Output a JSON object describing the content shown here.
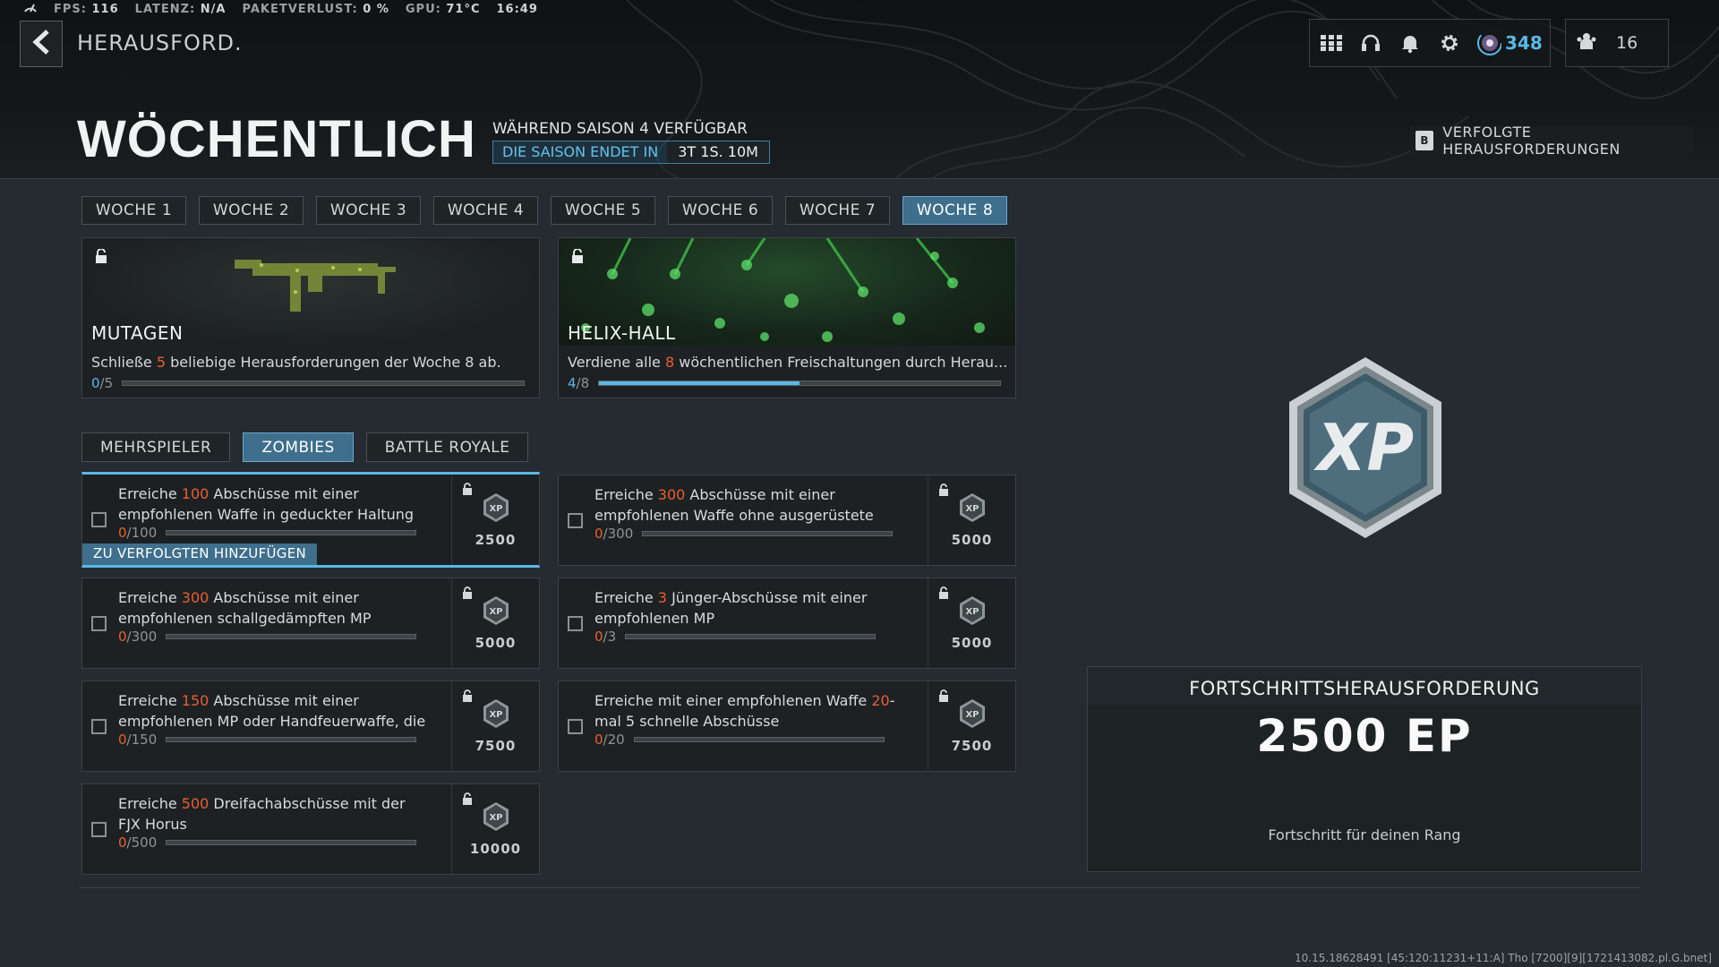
{
  "status_bar": {
    "fps_label": "FPS:",
    "fps": "116",
    "latency_label": "LATENZ:",
    "latency": "N/A",
    "packetloss_label": "PAKETVERLUST:",
    "packetloss": "0 %",
    "gpu_label": "GPU:",
    "gpu": "71°C",
    "clock": "16:49"
  },
  "header": {
    "breadcrumb": "HERAUSFORD.",
    "title": "WÖCHENTLICH",
    "availability": "WÄHREND SAISON 4 VERFÜGBAR",
    "season_end_label": "DIE SAISON ENDET IN",
    "season_end_value": "3T 1S. 10M",
    "tracked_key": "B",
    "tracked_label": "VERFOLGTE HERAUSFORDERUNGEN"
  },
  "top_icons": {
    "rank_value": "348",
    "friends_count": "16",
    "icons": [
      "grid-icon",
      "headset-icon",
      "bell-icon",
      "gear-icon",
      "rank-emblem-icon",
      "friends-icon"
    ]
  },
  "weeks": [
    "WOCHE 1",
    "WOCHE 2",
    "WOCHE 3",
    "WOCHE 4",
    "WOCHE 5",
    "WOCHE 6",
    "WOCHE 7",
    "WOCHE 8"
  ],
  "selected_week": 7,
  "rewards": [
    {
      "name": "MUTAGEN",
      "desc_pre": "Schließe ",
      "desc_num": "5",
      "desc_post": " beliebige Herausforderungen der Woche 8 ab.",
      "progress_cur": "0",
      "progress_sep": "/",
      "progress_max": "5",
      "progress_fraction": 0.0
    },
    {
      "name": "HELIX-HALL",
      "desc_pre": "Verdiene alle ",
      "desc_num": "8",
      "desc_post": " wöchentlichen Freischaltungen durch Herau...",
      "progress_cur": "4",
      "progress_sep": "/",
      "progress_max": "8",
      "progress_fraction": 0.5
    }
  ],
  "modes": [
    "MEHRSPIELER",
    "ZOMBIES",
    "BATTLE ROYALE"
  ],
  "selected_mode": 1,
  "challenges": [
    {
      "pre": "Erreiche ",
      "num": "100",
      "post": " Abschüsse mit einer empfohlenen Waffe in geduckter Haltung",
      "cur": "0",
      "sep": "/",
      "max": "100",
      "xp": "2500",
      "progress_fraction": 0.0
    },
    {
      "pre": "Erreiche ",
      "num": "300",
      "post": " Abschüsse mit einer empfohlenen Waffe ohne ausgerüstete",
      "cur": "0",
      "sep": "/",
      "max": "300",
      "xp": "5000",
      "progress_fraction": 0.0
    },
    {
      "pre": "Erreiche ",
      "num": "300",
      "post": " Abschüsse mit einer empfohlenen schallgedämpften MP",
      "cur": "0",
      "sep": "/",
      "max": "300",
      "xp": "5000",
      "progress_fraction": 0.0
    },
    {
      "pre": "Erreiche ",
      "num": "3",
      "post": " Jünger-Abschüsse mit einer empfohlenen MP",
      "cur": "0",
      "sep": "/",
      "max": "3",
      "xp": "5000",
      "progress_fraction": 0.0
    },
    {
      "pre": "Erreiche ",
      "num": "150",
      "post": " Abschüsse mit einer empfohlenen MP oder Handfeuerwaffe, die",
      "cur": "0",
      "sep": "/",
      "max": "150",
      "xp": "7500",
      "progress_fraction": 0.0
    },
    {
      "pre": "Erreiche mit einer empfohlenen Waffe ",
      "num": "20",
      "post": "-mal 5 schnelle Abschüsse",
      "cur": "0",
      "sep": "/",
      "max": "20",
      "xp": "7500",
      "progress_fraction": 0.0
    },
    {
      "pre": "Erreiche ",
      "num": "500",
      "post": " Dreifachabschüsse mit der FJX Horus",
      "cur": "0",
      "sep": "/",
      "max": "500",
      "xp": "10000",
      "progress_fraction": 0.0
    }
  ],
  "add_to_tracked": "ZU VERFOLGTEN HINZUFÜGEN",
  "prize": {
    "header": "FORTSCHRITTSHERAUSFORDERUNG",
    "value": "2500 EP",
    "footer": "Fortschritt für deinen Rang",
    "badge_text": "XP"
  },
  "build_string": "10.15.18628491 [45:120:11231+11:A] Tho [7200][9][1721413082.pl.G.bnet]",
  "colors": {
    "accent_blue": "#5ab8e6",
    "highlight_orange": "#e8602f",
    "selected_tab": "#3f6f8c"
  }
}
